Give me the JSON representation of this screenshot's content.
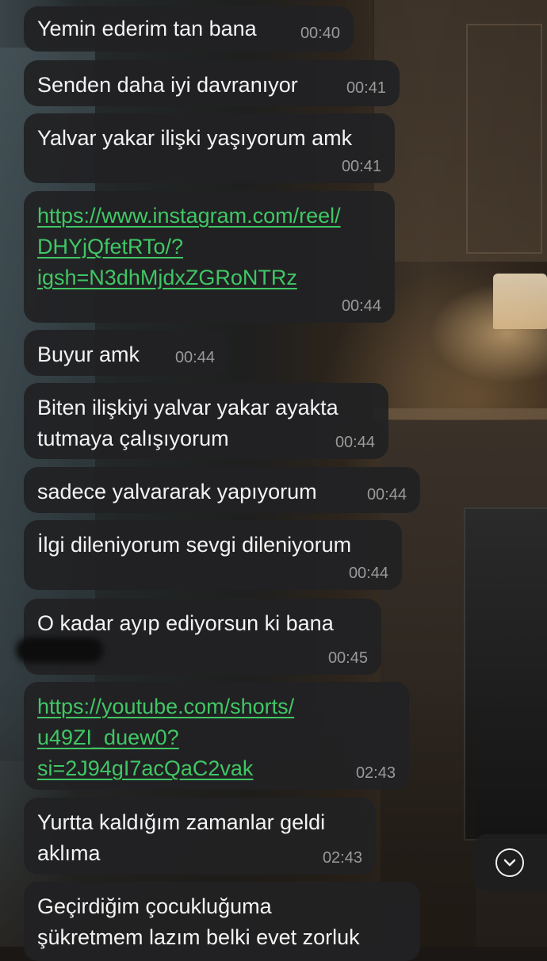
{
  "messages": [
    {
      "text": "Yemin ederim tan bana",
      "time": "00:40"
    },
    {
      "text": "Senden daha iyi davranıyor",
      "time": "00:41"
    },
    {
      "text": "Yalvar yakar ilişki yaşıyorum amk",
      "time": "00:41"
    },
    {
      "link_lines": [
        "https://www.instagram.com/reel/",
        "DHYjQfetRTo/?",
        "igsh=N3dhMjdxZGRoNTRz"
      ],
      "time": "00:44"
    },
    {
      "text": "Buyur amk",
      "time": "00:44"
    },
    {
      "lines": [
        "Biten ilişkiyi yalvar yakar ayakta",
        "tutmaya çalışıyorum"
      ],
      "time": "00:44"
    },
    {
      "text": "sadece yalvararak yapıyorum",
      "time": "00:44"
    },
    {
      "text": "İlgi dileniyorum sevgi dileniyorum",
      "time": "00:44"
    },
    {
      "text": "O kadar ayıp ediyorsun ki bana",
      "time": "00:45"
    },
    {
      "link_lines": [
        "https://youtube.com/shorts/",
        "u49ZI_duew0?",
        "si=2J94gI7acQaC2vak"
      ],
      "time": "02:43"
    },
    {
      "lines": [
        "Yurtta kaldığım zamanlar geldi",
        "aklıma"
      ],
      "time": "02:43"
    },
    {
      "lines": [
        "Geçirdiğim çocukluğuma",
        "şükretmem lazım belki evet zorluk"
      ]
    }
  ],
  "scroll_button": {
    "icon": "chevron-down-circle-icon"
  },
  "colors": {
    "bubble": "#212123",
    "text": "#f3f3f3",
    "link": "#40c765",
    "time": "#9a9a9a"
  }
}
